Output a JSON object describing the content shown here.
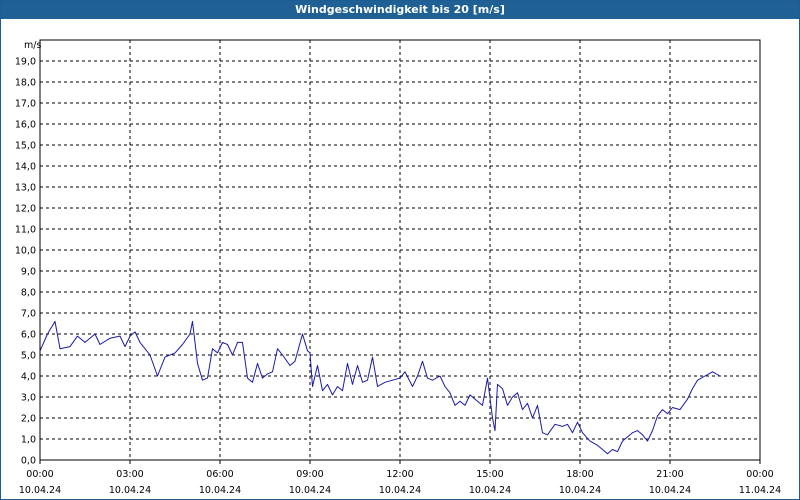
{
  "window": {
    "title": "Windgeschwindigkeit bis 20 [m/s]"
  },
  "chart_data": {
    "type": "line",
    "title": "Windgeschwindigkeit bis 20 [m/s]",
    "ylabel": "m/s",
    "ylim": [
      0,
      20
    ],
    "y_ticks": [
      "0,0",
      "1,0",
      "2,0",
      "3,0",
      "4,0",
      "5,0",
      "6,0",
      "7,0",
      "8,0",
      "9,0",
      "10,0",
      "11,0",
      "12,0",
      "13,0",
      "14,0",
      "15,0",
      "16,0",
      "17,0",
      "18,0",
      "19,0"
    ],
    "x_ticks": [
      {
        "time": "00:00",
        "date": "10.04.24"
      },
      {
        "time": "03:00",
        "date": "10.04.24"
      },
      {
        "time": "06:00",
        "date": "10.04.24"
      },
      {
        "time": "09:00",
        "date": "10.04.24"
      },
      {
        "time": "12:00",
        "date": "10.04.24"
      },
      {
        "time": "15:00",
        "date": "10.04.24"
      },
      {
        "time": "18:00",
        "date": "10.04.24"
      },
      {
        "time": "21:00",
        "date": "10.04.24"
      },
      {
        "time": "00:00",
        "date": "11.04.24"
      }
    ],
    "xlim": [
      "10.04.24 00:00",
      "11.04.24 00:00"
    ],
    "grid": true,
    "line_color": "#1a1aa6",
    "series": [
      {
        "points": [
          [
            "00:00",
            5.2
          ],
          [
            "00:15",
            6.0
          ],
          [
            "00:30",
            6.6
          ],
          [
            "00:40",
            5.3
          ],
          [
            "01:00",
            5.4
          ],
          [
            "01:15",
            5.9
          ],
          [
            "01:30",
            5.6
          ],
          [
            "01:50",
            6.0
          ],
          [
            "02:00",
            5.5
          ],
          [
            "02:20",
            5.8
          ],
          [
            "02:40",
            5.9
          ],
          [
            "02:50",
            5.4
          ],
          [
            "03:00",
            5.9
          ],
          [
            "03:10",
            6.1
          ],
          [
            "03:20",
            5.6
          ],
          [
            "03:40",
            5.0
          ],
          [
            "03:55",
            4.0
          ],
          [
            "04:10",
            4.9
          ],
          [
            "04:30",
            5.1
          ],
          [
            "04:45",
            5.5
          ],
          [
            "05:00",
            6.0
          ],
          [
            "05:05",
            6.6
          ],
          [
            "05:15",
            4.6
          ],
          [
            "05:25",
            3.8
          ],
          [
            "05:35",
            3.9
          ],
          [
            "05:45",
            5.3
          ],
          [
            "05:55",
            5.1
          ],
          [
            "06:05",
            5.6
          ],
          [
            "06:15",
            5.5
          ],
          [
            "06:25",
            5.0
          ],
          [
            "06:35",
            5.6
          ],
          [
            "06:45",
            5.6
          ],
          [
            "06:55",
            3.9
          ],
          [
            "07:05",
            3.7
          ],
          [
            "07:15",
            4.6
          ],
          [
            "07:25",
            3.9
          ],
          [
            "07:35",
            4.1
          ],
          [
            "07:45",
            4.2
          ],
          [
            "07:55",
            5.3
          ],
          [
            "08:05",
            5.0
          ],
          [
            "08:20",
            4.5
          ],
          [
            "08:30",
            4.7
          ],
          [
            "08:45",
            6.0
          ],
          [
            "08:55",
            5.2
          ],
          [
            "09:00",
            5.1
          ],
          [
            "09:05",
            3.5
          ],
          [
            "09:15",
            4.5
          ],
          [
            "09:25",
            3.3
          ],
          [
            "09:35",
            3.6
          ],
          [
            "09:45",
            3.1
          ],
          [
            "09:55",
            3.5
          ],
          [
            "10:05",
            3.3
          ],
          [
            "10:15",
            4.6
          ],
          [
            "10:25",
            3.6
          ],
          [
            "10:35",
            4.5
          ],
          [
            "10:45",
            3.7
          ],
          [
            "10:55",
            3.8
          ],
          [
            "11:05",
            4.9
          ],
          [
            "11:15",
            3.5
          ],
          [
            "11:30",
            3.7
          ],
          [
            "11:45",
            3.8
          ],
          [
            "12:00",
            3.9
          ],
          [
            "12:10",
            4.2
          ],
          [
            "12:25",
            3.5
          ],
          [
            "12:35",
            4.0
          ],
          [
            "12:45",
            4.7
          ],
          [
            "12:55",
            3.9
          ],
          [
            "13:05",
            3.8
          ],
          [
            "13:20",
            4.0
          ],
          [
            "13:30",
            3.5
          ],
          [
            "13:40",
            3.2
          ],
          [
            "13:50",
            2.6
          ],
          [
            "14:00",
            2.8
          ],
          [
            "14:10",
            2.6
          ],
          [
            "14:20",
            3.1
          ],
          [
            "14:35",
            2.8
          ],
          [
            "14:45",
            2.6
          ],
          [
            "14:55",
            3.9
          ],
          [
            "15:05",
            2.0
          ],
          [
            "15:10",
            1.4
          ],
          [
            "15:15",
            3.6
          ],
          [
            "15:25",
            3.4
          ],
          [
            "15:35",
            2.6
          ],
          [
            "15:45",
            3.0
          ],
          [
            "15:55",
            3.2
          ],
          [
            "16:05",
            2.4
          ],
          [
            "16:15",
            2.7
          ],
          [
            "16:25",
            2.0
          ],
          [
            "16:35",
            2.6
          ],
          [
            "16:45",
            1.3
          ],
          [
            "16:55",
            1.2
          ],
          [
            "17:10",
            1.7
          ],
          [
            "17:25",
            1.6
          ],
          [
            "17:35",
            1.7
          ],
          [
            "17:45",
            1.3
          ],
          [
            "17:55",
            1.8
          ],
          [
            "18:05",
            1.3
          ],
          [
            "18:20",
            0.9
          ],
          [
            "18:35",
            0.7
          ],
          [
            "18:45",
            0.5
          ],
          [
            "18:55",
            0.3
          ],
          [
            "19:05",
            0.5
          ],
          [
            "19:15",
            0.4
          ],
          [
            "19:25",
            0.9
          ],
          [
            "19:35",
            1.1
          ],
          [
            "19:45",
            1.3
          ],
          [
            "19:55",
            1.4
          ],
          [
            "20:05",
            1.2
          ],
          [
            "20:15",
            0.9
          ],
          [
            "20:25",
            1.4
          ],
          [
            "20:35",
            2.1
          ],
          [
            "20:45",
            2.4
          ],
          [
            "20:55",
            2.2
          ],
          [
            "21:05",
            2.5
          ],
          [
            "21:20",
            2.4
          ],
          [
            "21:35",
            2.9
          ],
          [
            "21:45",
            3.4
          ],
          [
            "21:55",
            3.8
          ],
          [
            "22:10",
            4.0
          ],
          [
            "22:25",
            4.2
          ],
          [
            "22:40",
            4.0
          ]
        ]
      }
    ]
  }
}
